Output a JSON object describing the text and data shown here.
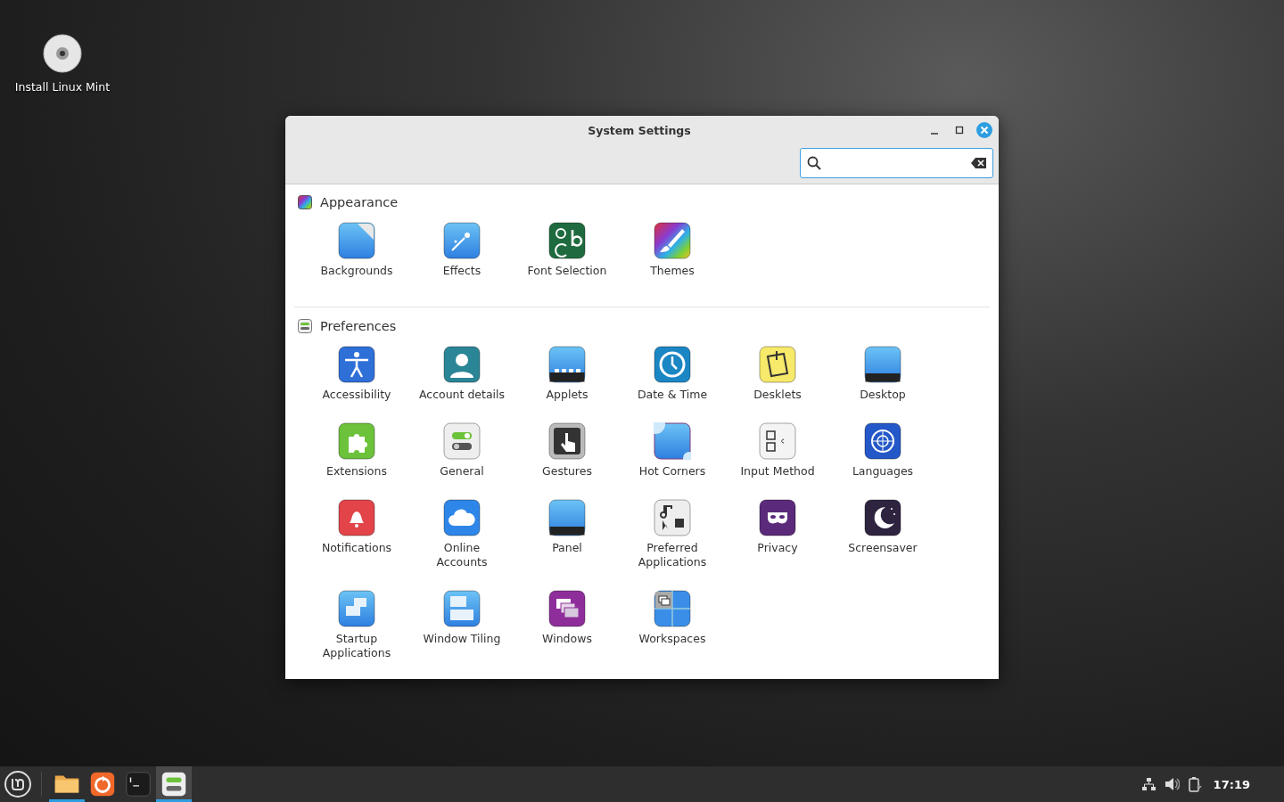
{
  "desktop_icons": [
    {
      "label": "Install Linux Mint"
    }
  ],
  "window": {
    "title": "System Settings"
  },
  "sections": [
    {
      "title": "Appearance",
      "items": [
        {
          "label": "Backgrounds"
        },
        {
          "label": "Effects"
        },
        {
          "label": "Font Selection"
        },
        {
          "label": "Themes"
        }
      ]
    },
    {
      "title": "Preferences",
      "items": [
        {
          "label": "Accessibility"
        },
        {
          "label": "Account details"
        },
        {
          "label": "Applets"
        },
        {
          "label": "Date & Time"
        },
        {
          "label": "Desklets"
        },
        {
          "label": "Desktop"
        },
        {
          "label": "Extensions"
        },
        {
          "label": "General"
        },
        {
          "label": "Gestures"
        },
        {
          "label": "Hot Corners"
        },
        {
          "label": "Input Method"
        },
        {
          "label": "Languages"
        },
        {
          "label": "Notifications"
        },
        {
          "label": "Online\nAccounts"
        },
        {
          "label": "Panel"
        },
        {
          "label": "Preferred\nApplications"
        },
        {
          "label": "Privacy"
        },
        {
          "label": "Screensaver"
        },
        {
          "label": "Startup\nApplications"
        },
        {
          "label": "Window Tiling"
        },
        {
          "label": "Windows"
        },
        {
          "label": "Workspaces"
        }
      ]
    }
  ],
  "taskbar": {
    "launchers": [
      {
        "running": true,
        "selected": false
      },
      {
        "running": false,
        "selected": false
      },
      {
        "running": false,
        "selected": false
      },
      {
        "running": true,
        "selected": true
      }
    ],
    "clock": "17:19"
  }
}
